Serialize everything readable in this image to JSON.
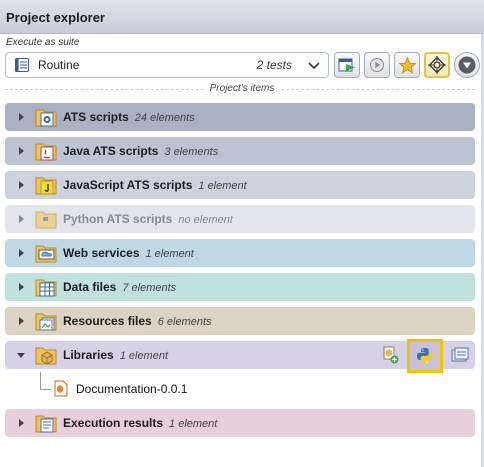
{
  "header": {
    "title": "Project explorer"
  },
  "suite": {
    "label": "Execute as suite",
    "selected": "Routine",
    "count": "2 tests"
  },
  "toolbar": {
    "buttons": [
      {
        "icon": "run-suite-icon"
      },
      {
        "icon": "play-icon"
      },
      {
        "icon": "star-icon"
      },
      {
        "icon": "target-icon",
        "active": true
      },
      {
        "icon": "filter-icon"
      }
    ]
  },
  "section": {
    "label": "Project's items"
  },
  "items": [
    {
      "title": "ATS scripts",
      "meta": "24 elements",
      "color": "#a9b1c3",
      "icon": "ats-scripts-folder-icon"
    },
    {
      "title": "Java ATS scripts",
      "meta": "3 elements",
      "color": "#bcc3d2",
      "icon": "java-folder-icon"
    },
    {
      "title": "JavaScript ATS scripts",
      "meta": "1 element",
      "color": "#cdd2dc",
      "icon": "javascript-folder-icon"
    },
    {
      "title": "Python ATS scripts",
      "meta": "no element",
      "color": "#e3e5ea",
      "icon": "python-folder-icon",
      "dim": true
    },
    {
      "title": "Web services",
      "meta": "1 element",
      "color": "#bfd8e6",
      "icon": "web-services-folder-icon"
    },
    {
      "title": "Data files",
      "meta": "7 elements",
      "color": "#bfe2dc",
      "icon": "data-files-folder-icon"
    },
    {
      "title": "Resources files",
      "meta": "6 elements",
      "color": "#ddd3c2",
      "icon": "resources-folder-icon"
    },
    {
      "title": "Libraries",
      "meta": "1 element",
      "color": "#d7d1e8",
      "icon": "libraries-folder-icon",
      "expanded": true
    },
    {
      "title": "Execution results",
      "meta": "1 element",
      "color": "#e7cfdc",
      "icon": "results-folder-icon"
    }
  ],
  "library_child": {
    "label": "Documentation-0.0.1"
  }
}
